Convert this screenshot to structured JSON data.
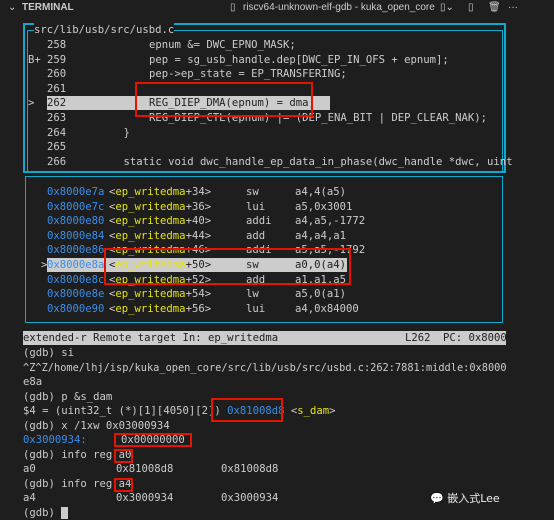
{
  "header": {
    "panel_title": "TERMINAL",
    "terminal_name": "riscv64-unknown-elf-gdb - kuka_open_core"
  },
  "source": {
    "file": "src/lib/usb/src/usbd.c",
    "lines": [
      {
        "marker": "",
        "num": "258",
        "code": "        epnum &= DWC_EPNO_MASK;"
      },
      {
        "marker": "B+",
        "num": "259",
        "code": "        pep = sg_usb_handle.dep[DWC_EP_IN_OFS + epnum];"
      },
      {
        "marker": "",
        "num": "260",
        "code": "        pep->ep_state = EP_TRANSFERING;"
      },
      {
        "marker": "",
        "num": "261",
        "code": ""
      },
      {
        "marker": ">",
        "num": "262",
        "code": "        REG_DIEP_DMA(epnum) = dma;",
        "current": true
      },
      {
        "marker": "",
        "num": "263",
        "code": "        REG_DIEP_CTL(epnum) |= (DEP_ENA_BIT | DEP_CLEAR_NAK);"
      },
      {
        "marker": "",
        "num": "264",
        "code": "    }"
      },
      {
        "marker": "",
        "num": "265",
        "code": ""
      },
      {
        "marker": "",
        "num": "266",
        "code": "    static void dwc_handle_ep_data_in_phase(dwc_handle *dwc, uint"
      }
    ]
  },
  "asm": {
    "rows": [
      {
        "marker": "",
        "addr": "0x8000e7a",
        "fn": "ep_writedma",
        "off": "+34",
        "op": "sw",
        "args": "a4,4(a5)"
      },
      {
        "marker": "",
        "addr": "0x8000e7c",
        "fn": "ep_writedma",
        "off": "+36",
        "op": "lui",
        "args": "a5,0x3001"
      },
      {
        "marker": "",
        "addr": "0x8000e80",
        "fn": "ep_writedma",
        "off": "+40",
        "op": "addi",
        "args": "a4,a5,-1772"
      },
      {
        "marker": "",
        "addr": "0x8000e84",
        "fn": "ep_writedma",
        "off": "+44",
        "op": "add",
        "args": "a4,a4,a1"
      },
      {
        "marker": "",
        "addr": "0x8000e86",
        "fn": "ep_writedma",
        "off": "+46",
        "op": "addi",
        "args": "a5,a5,-1792"
      },
      {
        "marker": ">",
        "addr": "0x8000e8a",
        "fn": "ep_writedma",
        "off": "+50",
        "op": "sw",
        "args": "a0,0(a4)",
        "current": true
      },
      {
        "marker": "",
        "addr": "0x8000e8c",
        "fn": "ep_writedma",
        "off": "+52",
        "op": "add",
        "args": "a1,a1,a5"
      },
      {
        "marker": "",
        "addr": "0x8000e8e",
        "fn": "ep_writedma",
        "off": "+54",
        "op": "lw",
        "args": "a5,0(a1)"
      },
      {
        "marker": "",
        "addr": "0x8000e90",
        "fn": "ep_writedma",
        "off": "+56",
        "op": "lui",
        "args": "a4,0x84000"
      }
    ]
  },
  "status": {
    "left": "extended-r Remote target In: ep_writedma",
    "line": "L262",
    "pc": "PC: 0x8000e8a"
  },
  "console": {
    "l1": "(gdb) si",
    "l2": "^Z^Z/home/lhj/isp/kuka_open_core/src/lib/usb/src/usbd.c:262:7881:middle:0x8000",
    "l3": "e8a",
    "l4": "(gdb) p &s_dam",
    "l5a": "$4 = (uint32_t (*)[1][4050][2]) ",
    "l5b": "0x81008d8",
    "l5c": " <",
    "l5d": "s_dam",
    "l5e": ">",
    "l6": "(gdb) x /1xw 0x03000934",
    "l7a": "0x3000934:",
    "l7b": "0x00000000",
    "l8a": "(gdb) info reg ",
    "l8b": "a0",
    "l9a": "a0",
    "l9b": "0x81008d8",
    "l9c": "0x81008d8",
    "l10a": "(gdb) info reg ",
    "l10b": "a4",
    "l11a": "a4",
    "l11b": "0x3000934",
    "l11c": "0x3000934",
    "l12": "(gdb) "
  },
  "watermark": "嵌入式Lee"
}
